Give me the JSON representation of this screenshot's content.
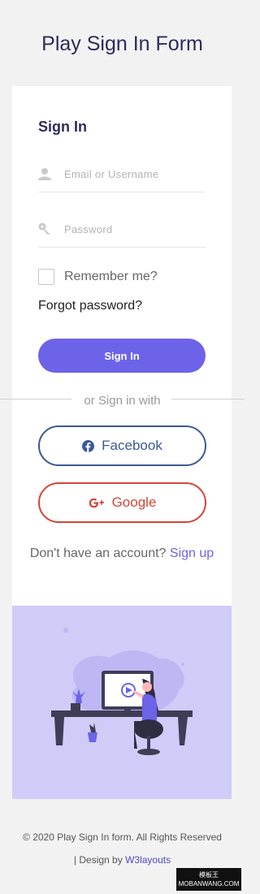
{
  "page_title": "Play Sign In Form",
  "form": {
    "heading": "Sign In",
    "username_placeholder": "Email or Username",
    "password_placeholder": "Password",
    "remember_label": "Remember me?",
    "forgot_label": "Forgot password?",
    "submit_label": "Sign In"
  },
  "social": {
    "divider_text": "or Sign in with",
    "facebook_label": "Facebook",
    "google_label": "Google"
  },
  "account": {
    "prompt": "Don't have an account? ",
    "signup_label": "Sign up"
  },
  "footer": {
    "copyright": "© 2020 Play Sign In form. All Rights Reserved",
    "design_prefix": "| Design by ",
    "design_link": "W3layouts"
  },
  "watermark": {
    "line1": "模板王",
    "line2": "MOBANWANG.COM"
  },
  "icons": {
    "user": "user-icon",
    "key": "key-icon",
    "facebook": "facebook-icon",
    "google": "google-plus-icon"
  },
  "colors": {
    "accent": "#6c63e8",
    "facebook": "#3b5998",
    "google": "#d44638",
    "illustration_bg": "#d1cbf8",
    "title": "#2f2b5a"
  }
}
